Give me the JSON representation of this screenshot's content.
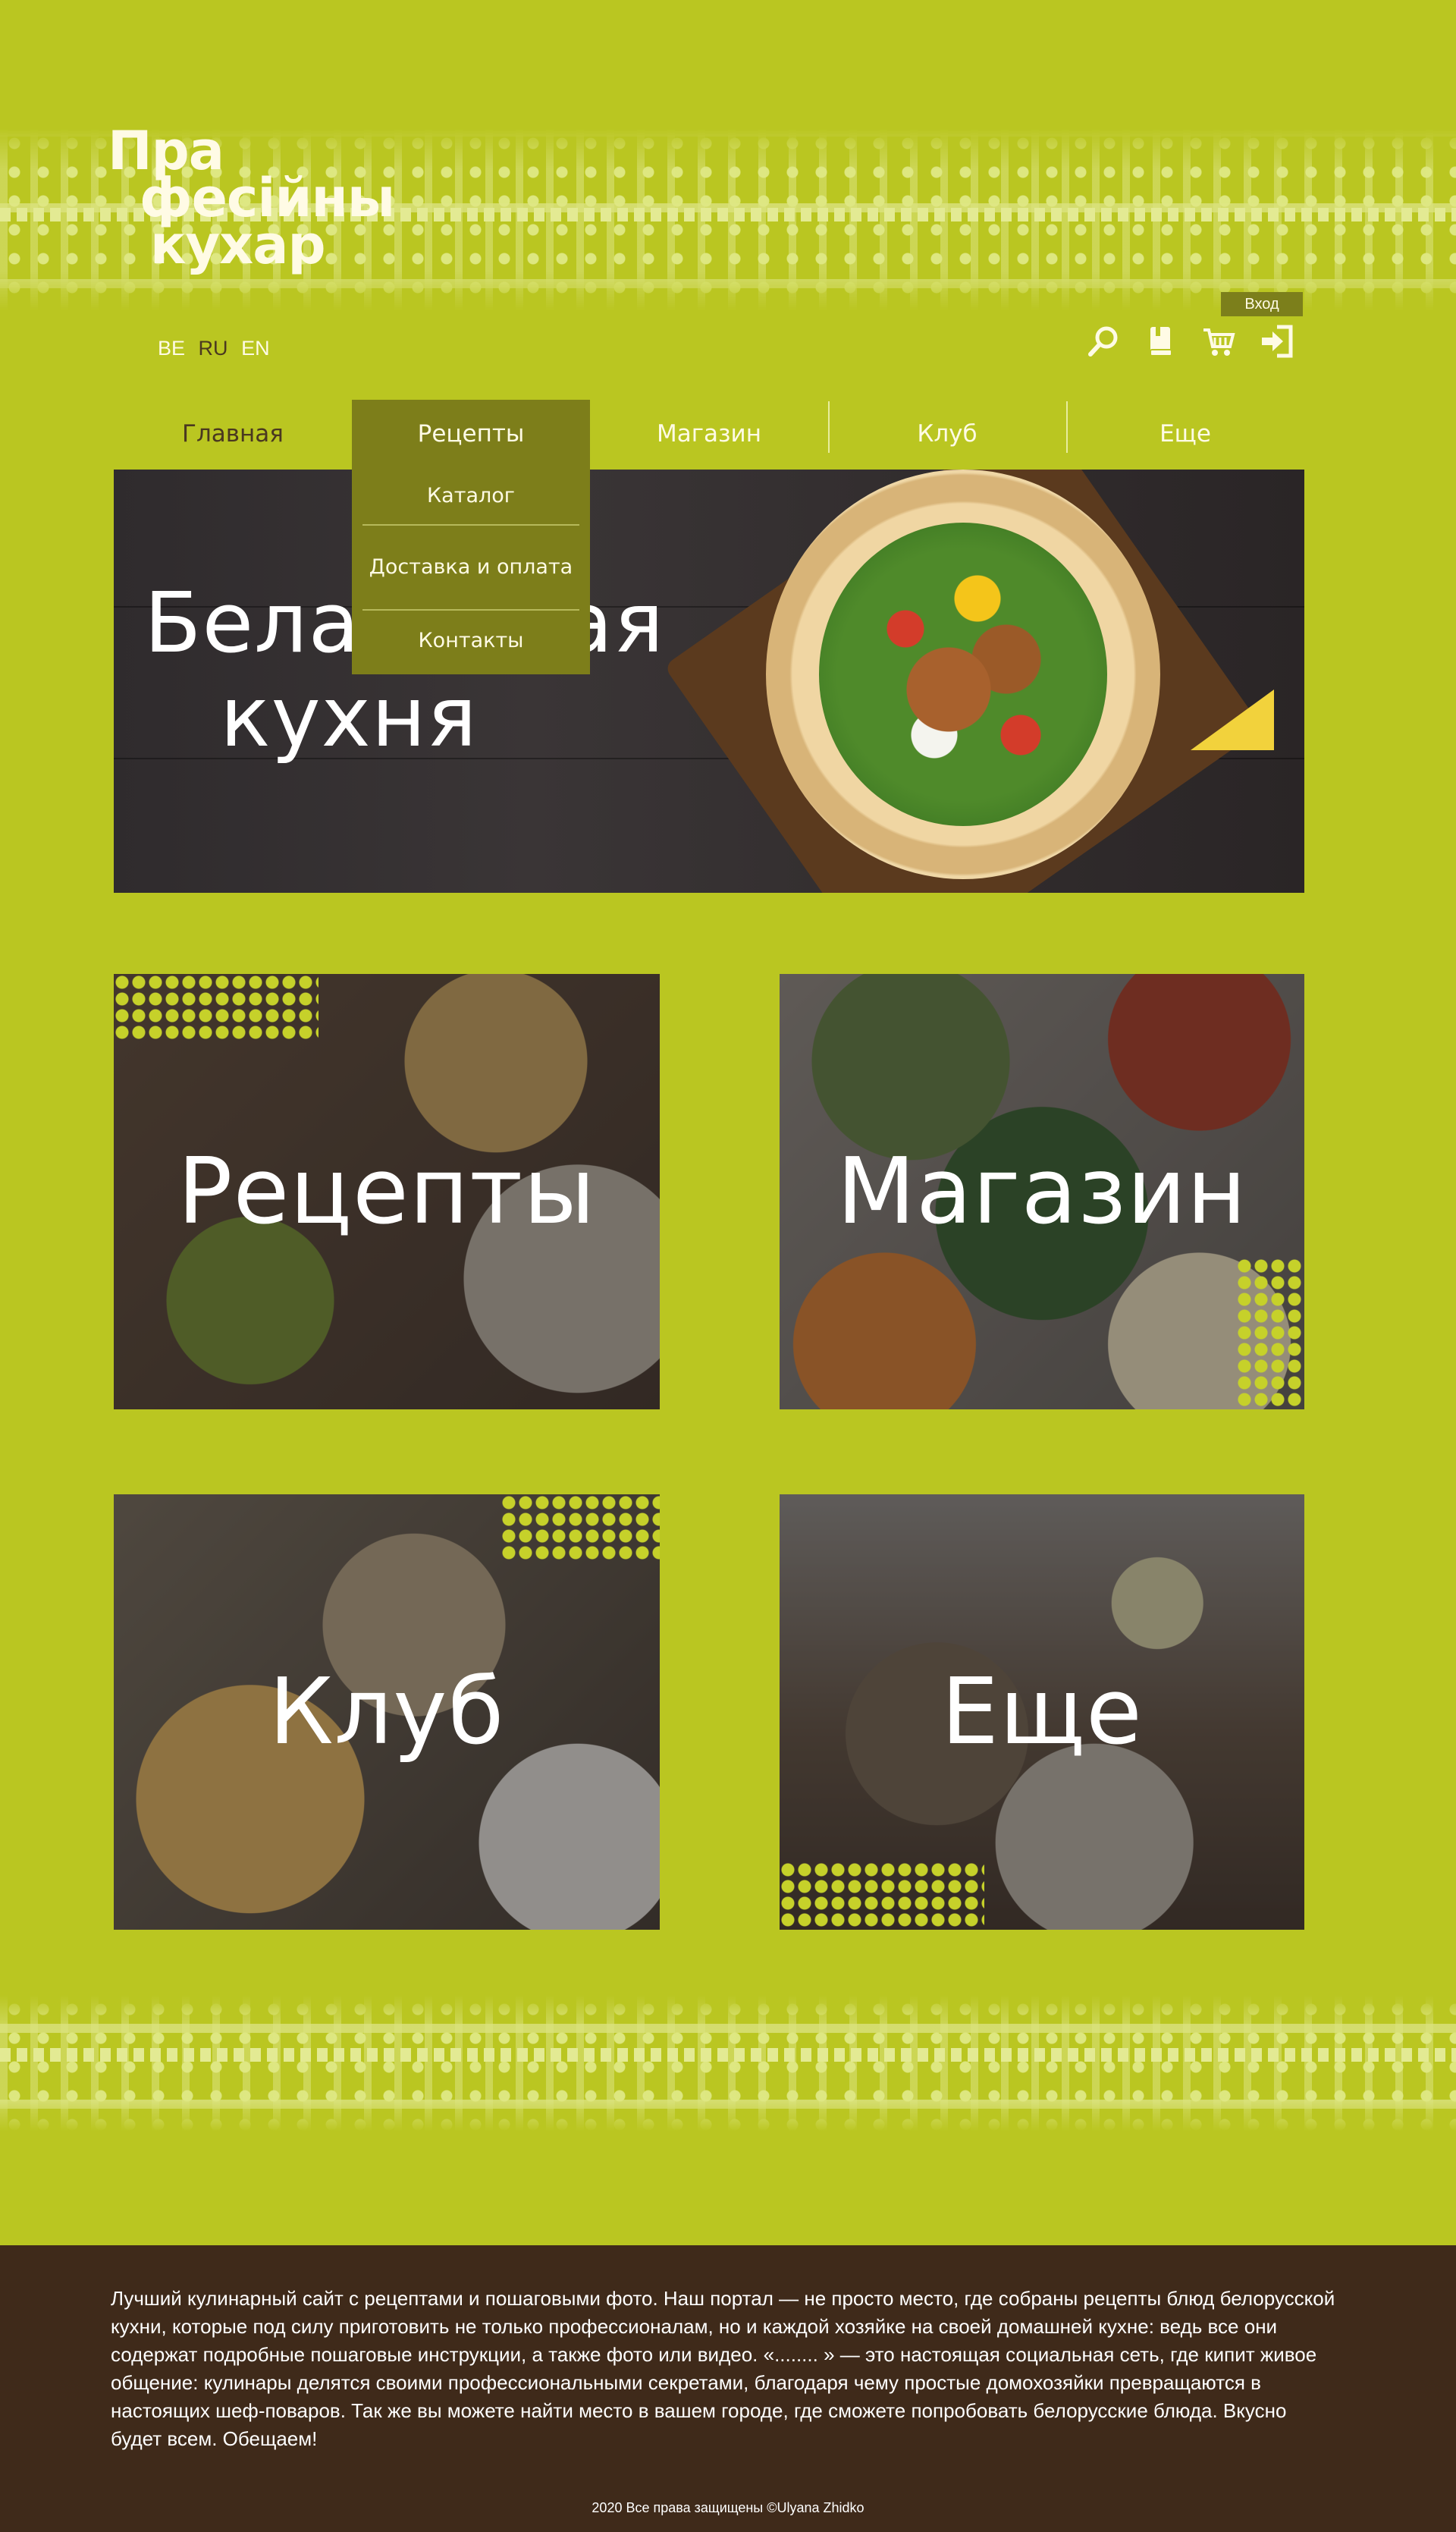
{
  "logo": {
    "line1": "Пра",
    "line2": "фесійны",
    "line3": "кухар"
  },
  "langs": [
    "BE",
    "RU",
    "EN"
  ],
  "active_lang": "RU",
  "header": {
    "login_label": "Вход"
  },
  "nav": {
    "items": [
      {
        "label": "Главная"
      },
      {
        "label": "Рецепты"
      },
      {
        "label": "Магазин"
      },
      {
        "label": "Клуб"
      },
      {
        "label": "Еще"
      }
    ],
    "dropdown": [
      "Каталог",
      "Доставка и оплата",
      "Контакты"
    ]
  },
  "hero": {
    "title": "Беларуская кухня"
  },
  "tiles": {
    "recipes": "Рецепты",
    "shop": "Магазин",
    "club": "Клуб",
    "more": "Еще"
  },
  "footer": {
    "text": "Лучший кулинарный сайт с рецептами и пошаговыми фото. Наш портал — не просто место, где собраны рецепты блюд белорусской кухни, которые под силу приготовить не только профессионалам, но и каждой хозяйке на своей домашней кухне: ведь все они содержат подробные пошаговые инструкции, а также фото или видео. «........ » — это настоящая социальная сеть, где кипит живое общение: кулинары делятся своими профессиональными секретами, благодаря чему простые домохозяйки превращаются в настоящих шеф-поваров. Так же вы можете найти место в вашем городе, где сможете попробовать белорусские блюда. Вкусно будет всем. Обещаем!",
    "copyright": "2020  Все права защищены ©Ulyana Zhidko"
  },
  "colors": {
    "background": "#bac621",
    "accent_dark": "#7d7e1a",
    "footer": "#3f2a1a",
    "text_light": "#fffbe5"
  },
  "icons": [
    "search-icon",
    "book-icon",
    "cart-icon",
    "login-icon"
  ]
}
